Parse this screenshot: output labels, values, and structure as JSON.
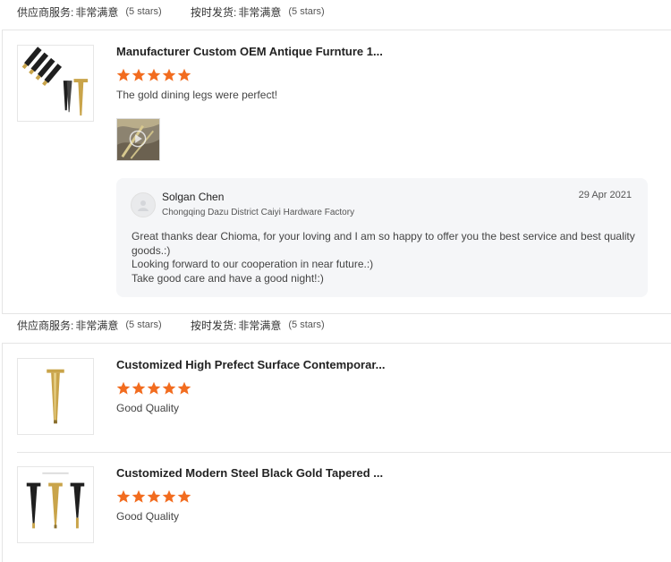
{
  "rating_bar": {
    "supplier_service_label": "供应商服务:",
    "supplier_service_value": "非常满意",
    "supplier_service_stars": "(5 stars)",
    "ontime_delivery_label": "按时发货:",
    "ontime_delivery_value": "非常满意",
    "ontime_delivery_stars": "(5 stars)"
  },
  "reviews": [
    {
      "product_title": "Manufacturer Custom OEM Antique Furnture 1...",
      "rating": 5,
      "comment": "The gold dining legs were perfect!",
      "has_media": true,
      "reply": {
        "name": "Solgan Chen",
        "company": "Chongqing Dazu District Caiyi Hardware Factory",
        "date": "29 Apr 2021",
        "lines": [
          "Great thanks dear Chioma, for your loving and I am so happy to offer you the best service and best quality",
          "goods.:)",
          "Looking forward to our cooperation in near future.:)",
          "Take good care and have a good night!:)"
        ]
      }
    },
    {
      "product_title": "Customized High Prefect Surface Contemporar...",
      "rating": 5,
      "comment": "Good Quality"
    },
    {
      "product_title": "Customized Modern Steel Black Gold Tapered ...",
      "rating": 5,
      "comment": "Good Quality"
    }
  ],
  "colors": {
    "star": "#f26c1f",
    "gold": "#c9a44a",
    "black": "#1f1f1f",
    "reply_bg": "#f5f6f8"
  },
  "icons": {
    "star": "star-icon",
    "play": "play-icon",
    "avatar": "user-avatar-icon"
  }
}
